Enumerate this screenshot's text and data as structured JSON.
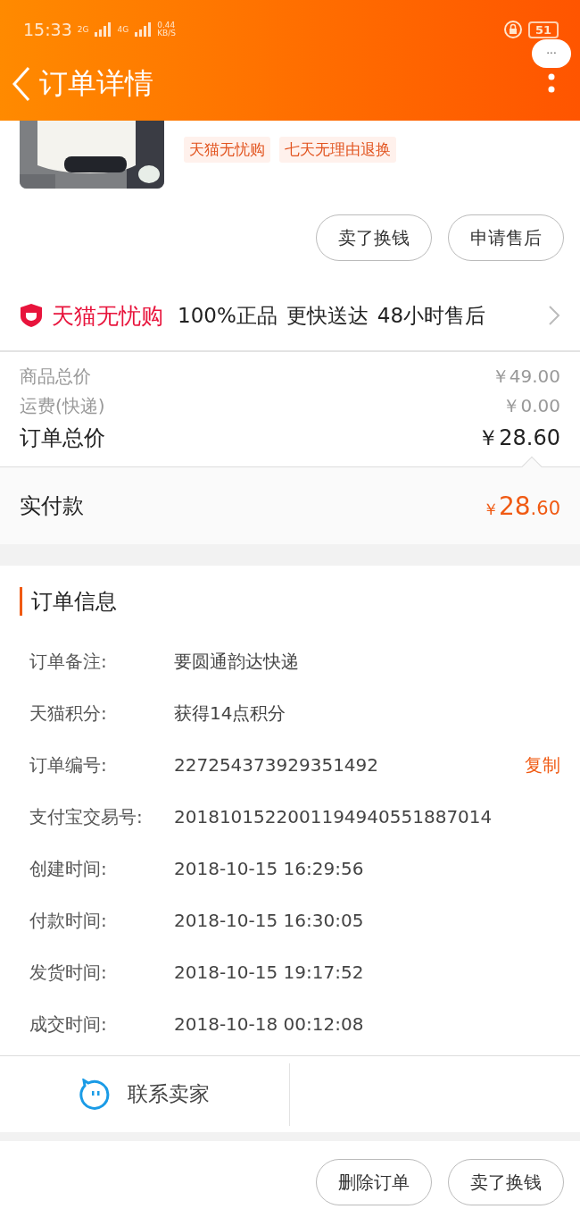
{
  "status_bar": {
    "time": "15:33",
    "signal_1": "2G",
    "signal_2": "4G",
    "speed": "0.44",
    "speed_unit": "KB/S",
    "battery": "51"
  },
  "header": {
    "title": "订单详情",
    "more": "···"
  },
  "product": {
    "tags": [
      "天猫无忧购",
      "七天无理由退换"
    ],
    "actions": [
      "卖了换钱",
      "申请售后"
    ]
  },
  "tmall_bar": {
    "brand": "天猫无忧购",
    "features": [
      "100%正品",
      "更快送达",
      "48小时售后"
    ]
  },
  "prices": [
    {
      "label": "商品总价",
      "value": "￥49.00",
      "kind": "minor"
    },
    {
      "label": "运费(快递)",
      "value": "￥0.00",
      "kind": "minor"
    },
    {
      "label": "订单总价",
      "value": "￥28.60",
      "kind": "total"
    }
  ],
  "paid": {
    "label": "实付款",
    "currency": "￥",
    "integer": "28",
    "decimal": ".60"
  },
  "order_info": {
    "title": "订单信息",
    "rows": [
      {
        "label": "订单备注:",
        "value": "要圆通韵达快递"
      },
      {
        "label": "天猫积分:",
        "value": "获得14点积分"
      },
      {
        "label": "订单编号:",
        "value": "227254373929351492",
        "action": "复制"
      },
      {
        "label": "支付宝交易号:",
        "value": "2018101522001194940551887014"
      },
      {
        "label": "创建时间:",
        "value": "2018-10-15 16:29:56"
      },
      {
        "label": "付款时间:",
        "value": "2018-10-15 16:30:05"
      },
      {
        "label": "发货时间:",
        "value": "2018-10-15 19:17:52"
      },
      {
        "label": "成交时间:",
        "value": "2018-10-18 00:12:08"
      }
    ]
  },
  "contact": {
    "label": "联系卖家"
  },
  "bottom_actions": [
    "删除订单",
    "卖了换钱"
  ]
}
